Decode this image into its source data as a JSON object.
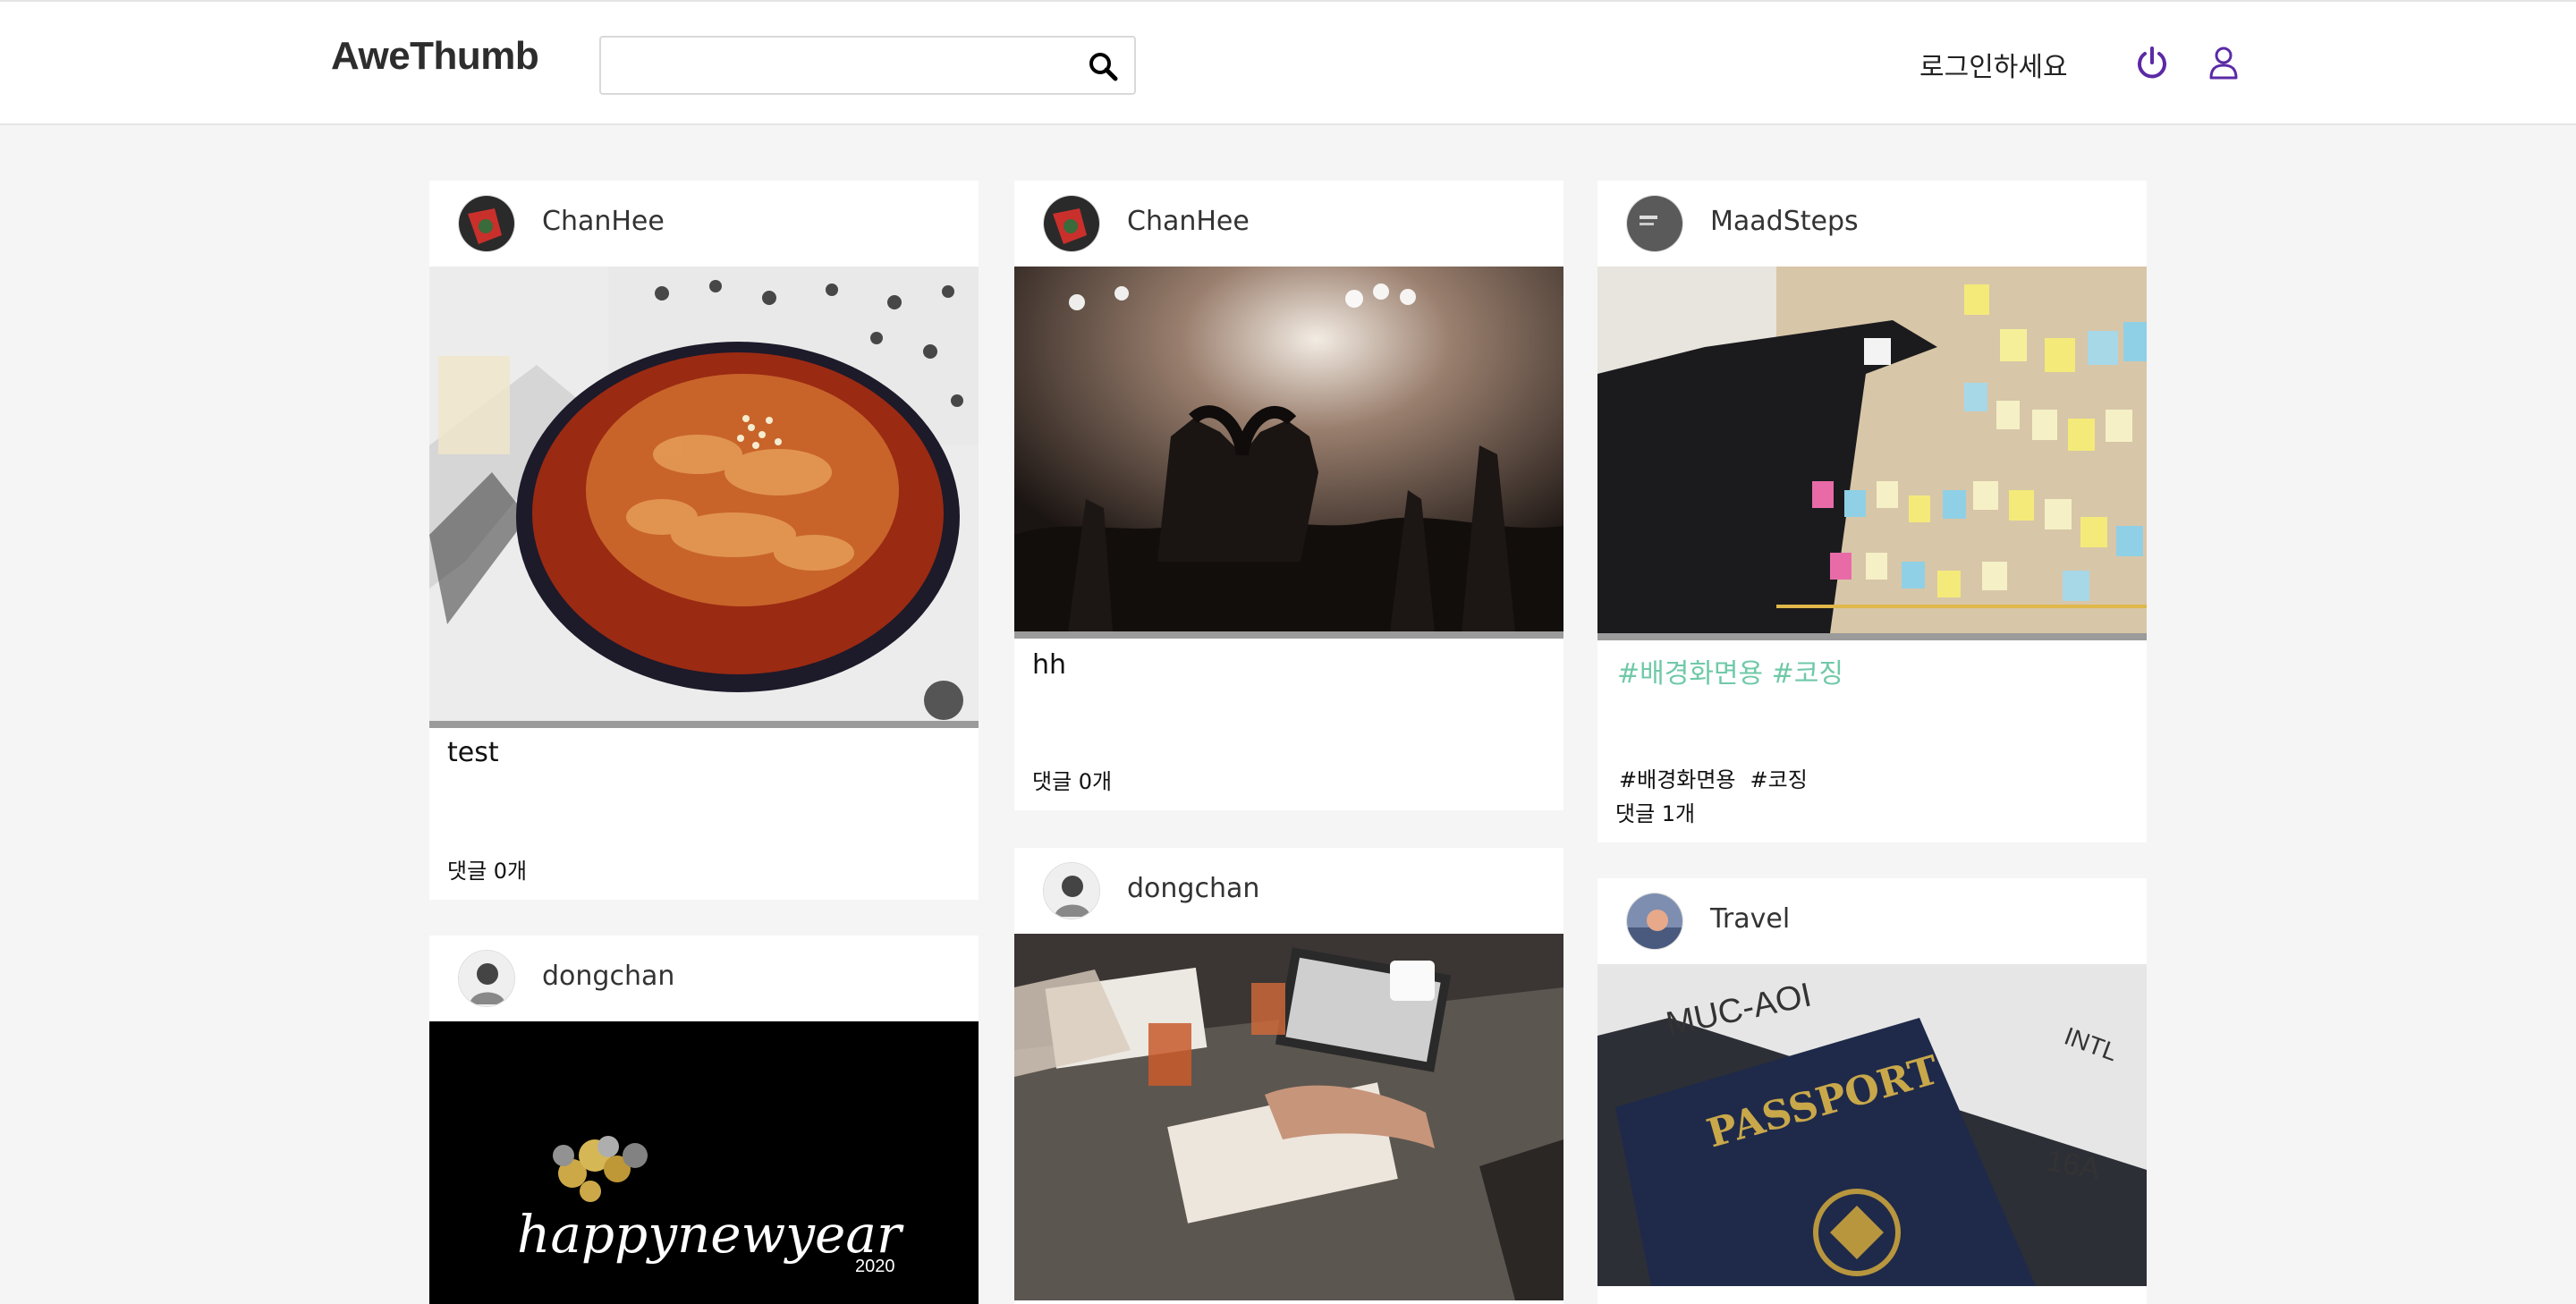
{
  "header": {
    "logo": "AweThumb",
    "search_placeholder": "",
    "login_text": "로그인하세요",
    "icons": [
      "search-icon",
      "power-icon",
      "user-icon"
    ]
  },
  "accent": "#5b2aa6",
  "tag_color": "#6fc9a8",
  "posts": [
    {
      "user": "ChanHee",
      "title": "test",
      "comments": "댓글 0개"
    },
    {
      "user": "ChanHee",
      "title": "hh",
      "comments": "댓글 0개"
    },
    {
      "user": "MaadSteps",
      "tag_title": "#배경화면용 #코징",
      "tags": [
        "#배경화면용",
        "#코징"
      ],
      "comments": "댓글 1개"
    },
    {
      "user": "dongchan",
      "image_text": "happynewyear",
      "image_year": "2020"
    },
    {
      "user": "dongchan"
    },
    {
      "user": "Travel",
      "image_text_1": "PASSPORT",
      "image_text_2": "MUC-AOI",
      "image_text_3": "INTL",
      "image_text_4": "16A"
    }
  ]
}
